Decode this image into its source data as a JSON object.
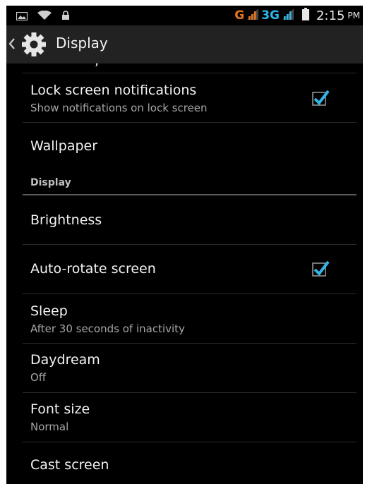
{
  "status_bar": {
    "network_g": "G",
    "network_3g": "3G",
    "time": "2:15",
    "ampm": "PM",
    "icons": [
      "image-icon",
      "wifi-icon",
      "lock-icon",
      "signal-icon",
      "battery-icon"
    ],
    "accent_orange": "#e8731c",
    "accent_blue": "#2fb6e8"
  },
  "action_bar": {
    "title": "Display",
    "icons": [
      "chevron-left-icon",
      "gear-icon"
    ]
  },
  "settings": {
    "lock_screen": {
      "title": "Lock screen notifications",
      "summary": "Show notifications on lock screen",
      "checked": true
    },
    "wallpaper": {
      "title": "Wallpaper"
    },
    "section_display": {
      "label": "Display"
    },
    "brightness": {
      "title": "Brightness"
    },
    "auto_rotate": {
      "title": "Auto-rotate screen",
      "checked": true
    },
    "sleep": {
      "title": "Sleep",
      "summary": "After 30 seconds of inactivity"
    },
    "daydream": {
      "title": "Daydream",
      "summary": "Off"
    },
    "font_size": {
      "title": "Font size",
      "summary": "Normal"
    },
    "cast_screen": {
      "title": "Cast screen"
    }
  },
  "colors": {
    "background": "#000000",
    "action_bar": "#222222",
    "checkbox_tick": "#33b5e5"
  }
}
